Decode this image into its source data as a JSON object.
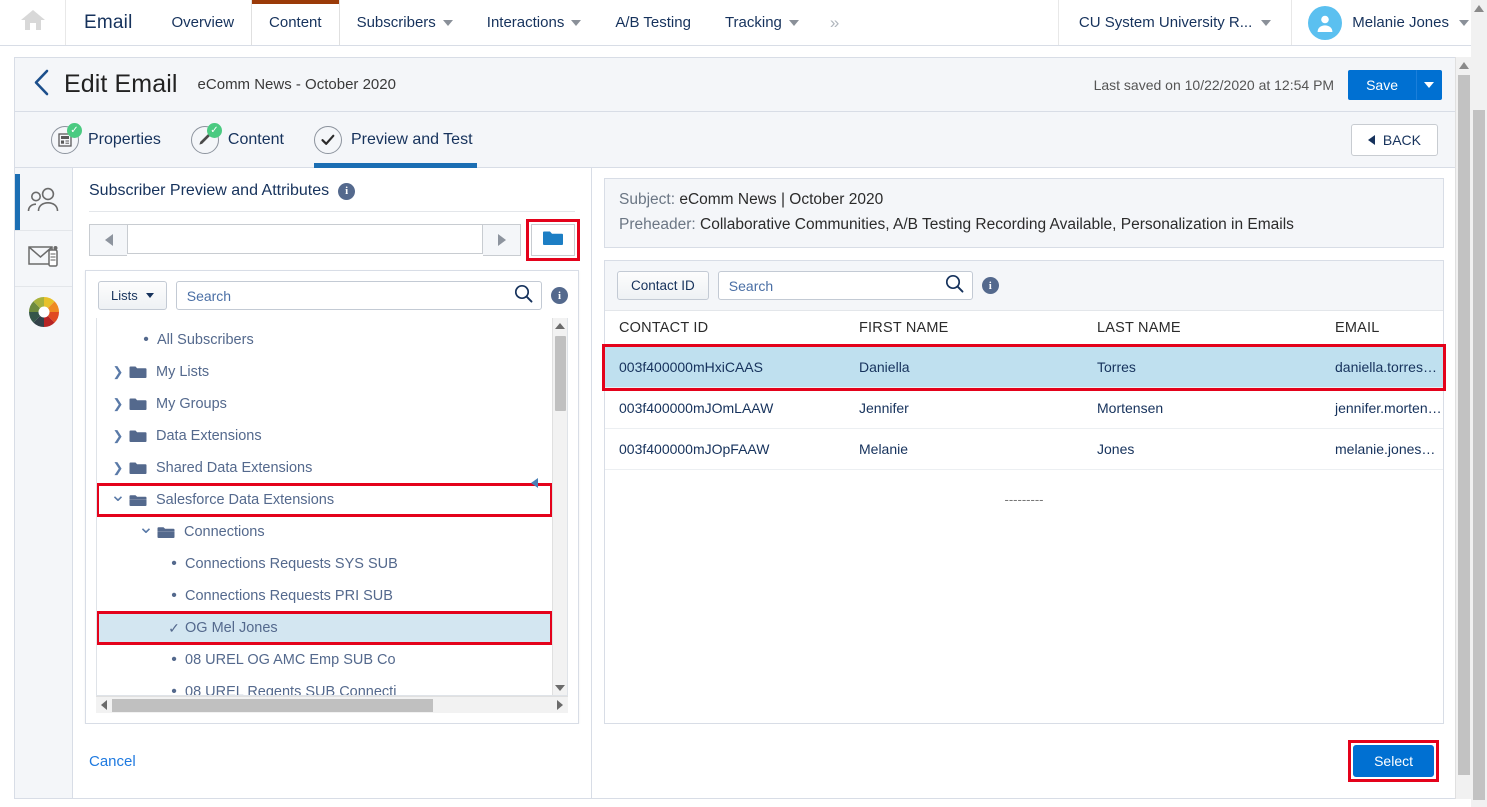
{
  "topnav": {
    "home_icon": "home-icon",
    "brand": "Email",
    "items": [
      {
        "label": "Overview",
        "has_caret": false,
        "active": false
      },
      {
        "label": "Content",
        "has_caret": false,
        "active": true
      },
      {
        "label": "Subscribers",
        "has_caret": true,
        "active": false
      },
      {
        "label": "Interactions",
        "has_caret": true,
        "active": false
      },
      {
        "label": "A/B Testing",
        "has_caret": false,
        "active": false
      },
      {
        "label": "Tracking",
        "has_caret": true,
        "active": false
      }
    ],
    "more_label": "»",
    "org": "CU System University R...",
    "user": "Melanie Jones"
  },
  "page": {
    "back_label": "‹",
    "title": "Edit Email",
    "subtitle": "eComm News - October 2020",
    "last_saved": "Last saved on 10/22/2020 at 12:54 PM",
    "save_label": "Save"
  },
  "steps": {
    "items": [
      {
        "label": "Properties",
        "state": "complete",
        "active": false
      },
      {
        "label": "Content",
        "state": "complete",
        "active": false
      },
      {
        "label": "Preview and Test",
        "state": "current",
        "active": true
      }
    ],
    "back_label": "BACK"
  },
  "rail": {
    "items": [
      {
        "icon": "subscribers-icon",
        "active": true
      },
      {
        "icon": "email-test-icon",
        "active": false
      },
      {
        "icon": "color-wheel-icon",
        "active": false
      }
    ]
  },
  "subscriber_preview": {
    "title": "Subscriber Preview and Attributes",
    "info_icon": "info-icon",
    "stepper_value": "",
    "stepper_placeholder": "",
    "prev_icon": "chevron-left-icon",
    "next_icon": "chevron-right-icon",
    "folder_icon": "folder-icon"
  },
  "picker": {
    "lists_button": "Lists",
    "search_placeholder": "Search",
    "search_value": "",
    "search_icon": "search-icon",
    "info_icon": "info-icon",
    "tree": [
      {
        "label": "All Subscribers",
        "indent": 1,
        "marker": "bullet",
        "folder": false,
        "highlight": false,
        "selected": false
      },
      {
        "label": "My Lists",
        "indent": 0,
        "marker": "collapsed",
        "folder": true,
        "highlight": false,
        "selected": false
      },
      {
        "label": "My Groups",
        "indent": 0,
        "marker": "collapsed",
        "folder": true,
        "highlight": false,
        "selected": false
      },
      {
        "label": "Data Extensions",
        "indent": 0,
        "marker": "collapsed",
        "folder": true,
        "highlight": false,
        "selected": false
      },
      {
        "label": "Shared Data Extensions",
        "indent": 0,
        "marker": "collapsed",
        "folder": true,
        "highlight": false,
        "selected": false
      },
      {
        "label": "Salesforce Data Extensions",
        "indent": 0,
        "marker": "expanded",
        "folder": true,
        "highlight": true,
        "selected": false
      },
      {
        "label": "Connections",
        "indent": 1,
        "marker": "expanded",
        "folder": true,
        "highlight": false,
        "selected": false
      },
      {
        "label": "Connections Requests SYS SUB",
        "indent": 2,
        "marker": "bullet",
        "folder": false,
        "highlight": false,
        "selected": false
      },
      {
        "label": "Connections Requests PRI SUB",
        "indent": 2,
        "marker": "bullet",
        "folder": false,
        "highlight": false,
        "selected": false
      },
      {
        "label": "OG Mel Jones",
        "indent": 2,
        "marker": "check",
        "folder": false,
        "highlight": true,
        "selected": true
      },
      {
        "label": "08 UREL OG AMC Emp SUB Co",
        "indent": 2,
        "marker": "bullet",
        "folder": false,
        "highlight": false,
        "selected": false
      },
      {
        "label": "08 UREL Regents SUB Connecti",
        "indent": 2,
        "marker": "bullet",
        "folder": false,
        "highlight": false,
        "selected": false
      }
    ],
    "cancel_label": "Cancel"
  },
  "email_summary": {
    "subject_label": "Subject:",
    "subject_value": "eComm News | October 2020",
    "preheader_label": "Preheader:",
    "preheader_value": "Collaborative Communities, A/B Testing Recording Available, Personalization in Emails"
  },
  "results": {
    "filter_button": "Contact ID",
    "search_placeholder": "Search",
    "search_value": "",
    "search_icon": "search-icon",
    "info_icon": "info-icon",
    "columns": [
      "CONTACT ID",
      "FIRST NAME",
      "LAST NAME",
      "EMAIL"
    ],
    "rows": [
      {
        "contact_id": "003f400000mHxiCAAS",
        "first_name": "Daniella",
        "last_name": "Torres",
        "email": "daniella.torres@cu.edu",
        "selected": true
      },
      {
        "contact_id": "003f400000mJOmLAAW",
        "first_name": "Jennifer",
        "last_name": "Mortensen",
        "email": "jennifer.mortensen@cu.edu",
        "selected": false
      },
      {
        "contact_id": "003f400000mJOpFAAW",
        "first_name": "Melanie",
        "last_name": "Jones",
        "email": "melanie.jones@cu.edu",
        "selected": false
      }
    ],
    "footer_marker": "---------",
    "select_label": "Select"
  },
  "colors": {
    "accent_blue": "#0070d2",
    "nav_active_bar": "#9a3a08",
    "step_active_bar": "#1b6eb3",
    "highlight_red": "#e4021b",
    "row_selected": "#bfe0ef",
    "tree_selected": "#d3e6f1",
    "success_green": "#4bca81",
    "avatar_blue": "#5bc0f0"
  }
}
